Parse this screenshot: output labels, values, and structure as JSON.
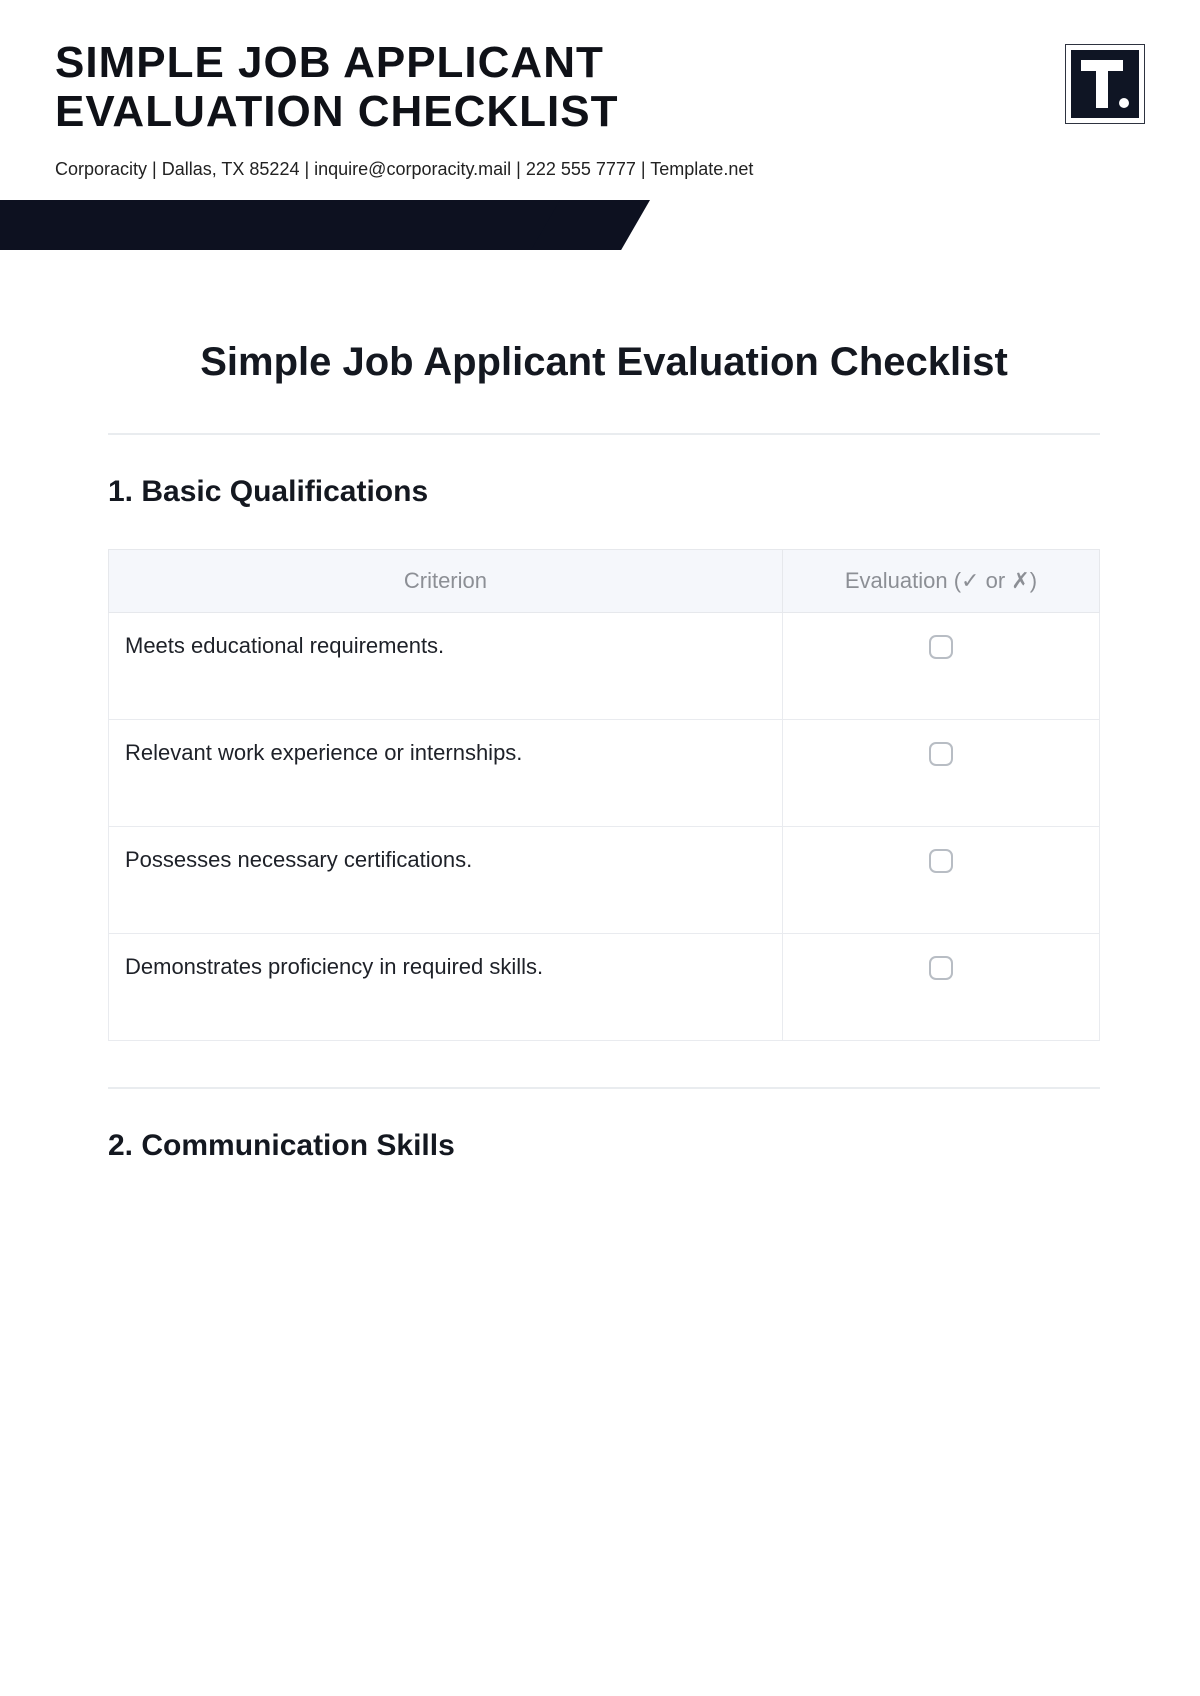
{
  "header": {
    "title_line1": "SIMPLE JOB APPLICANT",
    "title_line2": "EVALUATION CHECKLIST",
    "info_line": "Corporacity | Dallas, TX 85224 | inquire@corporacity.mail | 222 555 7777 | Template.net",
    "logo_letter": "T"
  },
  "document": {
    "heading": "Simple Job Applicant Evaluation Checklist",
    "sections": [
      {
        "number": "1.",
        "title": "Basic Qualifications",
        "columns": {
          "criterion": "Criterion",
          "evaluation": "Evaluation (✓ or ✗)"
        },
        "rows": [
          {
            "criterion": "Meets educational requirements.",
            "evaluated": false
          },
          {
            "criterion": "Relevant work experience or internships.",
            "evaluated": false
          },
          {
            "criterion": "Possesses necessary certifications.",
            "evaluated": false
          },
          {
            "criterion": "Demonstrates proficiency in required skills.",
            "evaluated": false
          }
        ]
      },
      {
        "number": "2.",
        "title": "Communication Skills"
      }
    ]
  }
}
